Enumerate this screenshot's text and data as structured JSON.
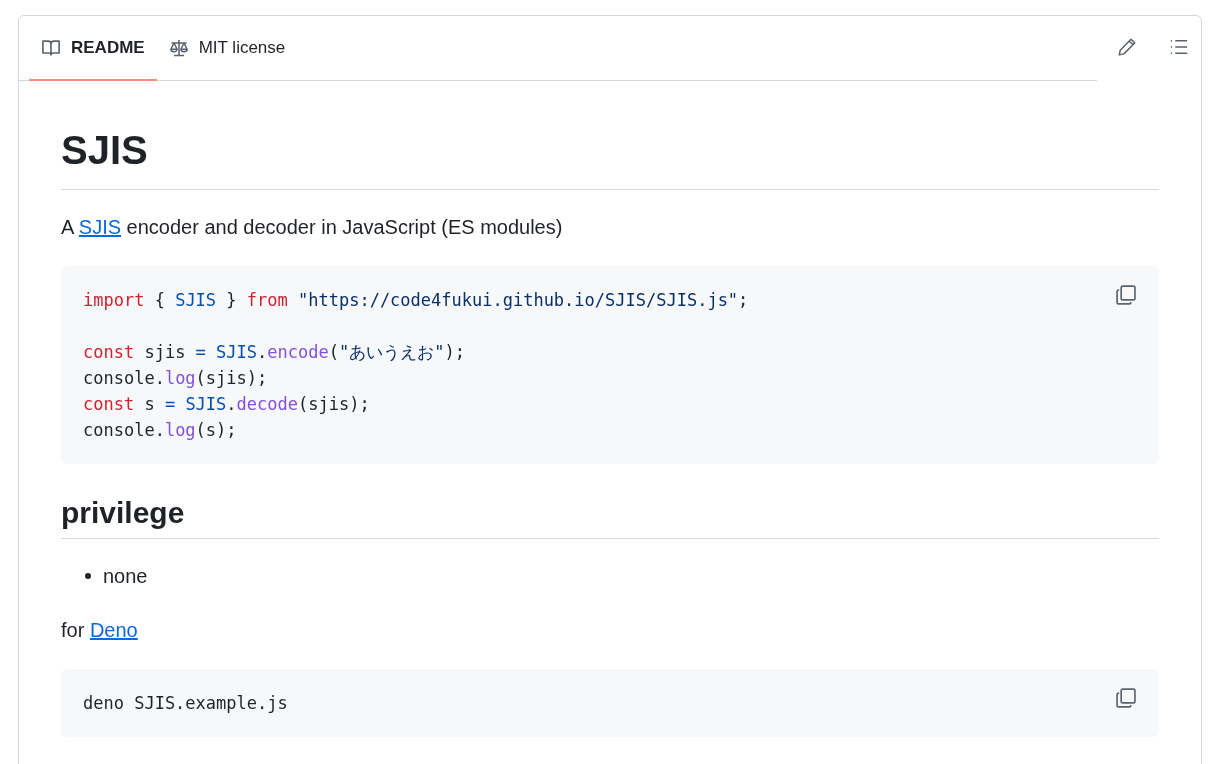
{
  "tabs": [
    {
      "label": "README",
      "selected": true
    },
    {
      "label": "MIT license",
      "selected": false
    }
  ],
  "blocks": [
    {
      "kind": "heading1",
      "text": "SJIS"
    },
    {
      "kind": "paragraph",
      "parts": [
        {
          "text": "A ",
          "link": false
        },
        {
          "text": "SJIS",
          "link": true
        },
        {
          "text": " encoder and decoder in JavaScript (ES modules)",
          "link": false
        }
      ]
    },
    {
      "kind": "code",
      "lines": [
        {
          "kind": "code",
          "tokens": [
            {
              "kind": "keyword",
              "text": "import"
            },
            {
              "kind": "plain",
              "text": " { "
            },
            {
              "kind": "entity",
              "text": "SJIS"
            },
            {
              "kind": "plain",
              "text": " } "
            },
            {
              "kind": "keyword",
              "text": "from"
            },
            {
              "kind": "string",
              "text": " \"https://code4fukui.github.io/SJIS/SJIS.js\""
            },
            {
              "kind": "plain",
              "text": ";"
            }
          ]
        },
        {
          "kind": "blank"
        },
        {
          "kind": "code",
          "tokens": [
            {
              "kind": "keyword",
              "text": "const"
            },
            {
              "kind": "plain",
              "text": " sjis "
            },
            {
              "kind": "entity",
              "text": "= SJIS"
            },
            {
              "kind": "plain",
              "text": "."
            },
            {
              "kind": "func",
              "text": "encode"
            },
            {
              "kind": "plain",
              "text": "("
            },
            {
              "kind": "string",
              "text": "\"あいうえお\""
            },
            {
              "kind": "plain",
              "text": ");"
            }
          ]
        },
        {
          "kind": "code",
          "tokens": [
            {
              "kind": "plain",
              "text": "console."
            },
            {
              "kind": "func",
              "text": "log"
            },
            {
              "kind": "plain",
              "text": "(sjis);"
            }
          ]
        },
        {
          "kind": "code",
          "tokens": [
            {
              "kind": "keyword",
              "text": "const"
            },
            {
              "kind": "plain",
              "text": " s "
            },
            {
              "kind": "entity",
              "text": "= SJIS"
            },
            {
              "kind": "plain",
              "text": "."
            },
            {
              "kind": "func",
              "text": "decode"
            },
            {
              "kind": "plain",
              "text": "(sjis);"
            }
          ]
        },
        {
          "kind": "code",
          "tokens": [
            {
              "kind": "plain",
              "text": "console."
            },
            {
              "kind": "func",
              "text": "log"
            },
            {
              "kind": "plain",
              "text": "(s);"
            }
          ]
        }
      ]
    },
    {
      "kind": "heading2",
      "text": "privilege"
    },
    {
      "kind": "list",
      "items": [
        "none"
      ]
    },
    {
      "kind": "paragraph",
      "parts": [
        {
          "text": "for ",
          "link": false
        },
        {
          "text": "Deno",
          "link": true
        }
      ]
    },
    {
      "kind": "code",
      "lines": [
        {
          "kind": "code",
          "tokens": [
            {
              "kind": "plain",
              "text": "deno SJIS.example.js"
            }
          ]
        }
      ]
    }
  ]
}
